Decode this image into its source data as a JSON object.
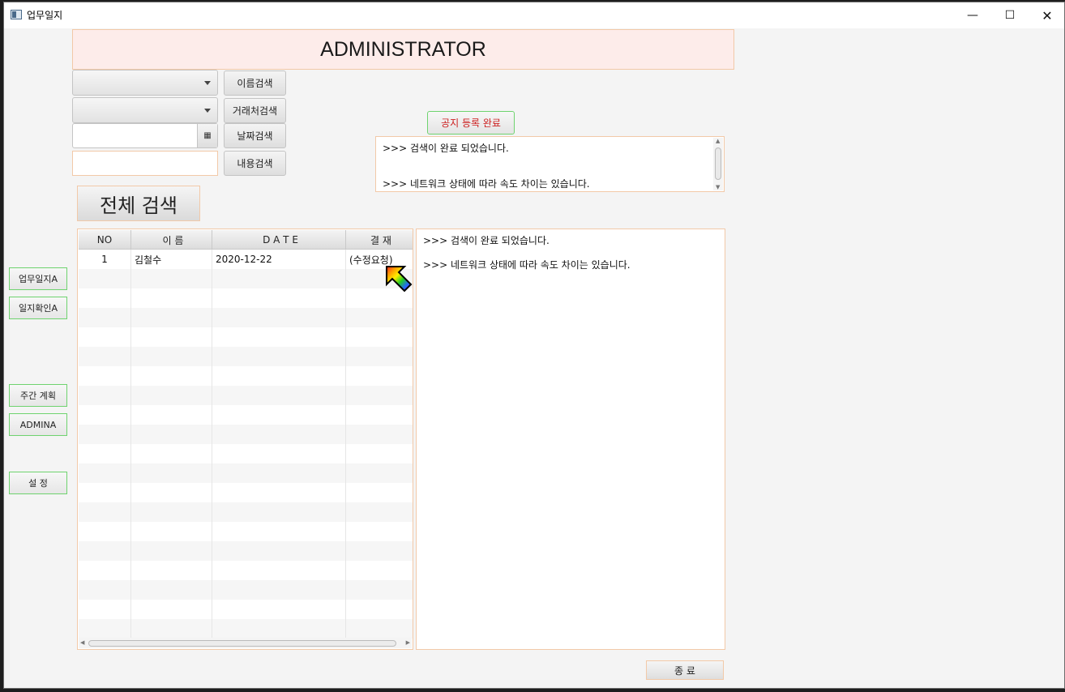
{
  "window": {
    "title": "업무일지",
    "min_glyph": "—",
    "max_glyph": "☐",
    "close_glyph": "✕"
  },
  "header": {
    "title": "ADMINISTRATOR"
  },
  "search": {
    "name_button": "이름검색",
    "client_button": "거래처검색",
    "date_button": "날짜검색",
    "content_button": "내용검색",
    "all_button": "전체 검색",
    "name_combo_value": "",
    "client_combo_value": "",
    "date_value": "",
    "content_value": "",
    "date_icon": "▦"
  },
  "notice": {
    "button": "공지 등록 완료",
    "log_lines": [
      ">>> 검색이 완료 되었습니다.",
      ">>> 네트워크 상태에 따라 속도 차이는 있습니다."
    ]
  },
  "nav": [
    {
      "label": "업무일지A"
    },
    {
      "label": "일지확인A"
    },
    {
      "label": "주간 계획"
    },
    {
      "label": "ADMINA"
    },
    {
      "label": "설  정"
    }
  ],
  "table": {
    "columns": [
      "NO",
      "이    름",
      "D  A  T  E",
      "결 재"
    ],
    "rows": [
      [
        "1",
        "김철수",
        "2020-12-22",
        "(수정요청)"
      ],
      [
        "",
        "",
        "",
        ""
      ],
      [
        "",
        "",
        "",
        ""
      ],
      [
        "",
        "",
        "",
        ""
      ],
      [
        "",
        "",
        "",
        ""
      ],
      [
        "",
        "",
        "",
        ""
      ],
      [
        "",
        "",
        "",
        ""
      ],
      [
        "",
        "",
        "",
        ""
      ],
      [
        "",
        "",
        "",
        ""
      ],
      [
        "",
        "",
        "",
        ""
      ],
      [
        "",
        "",
        "",
        ""
      ],
      [
        "",
        "",
        "",
        ""
      ],
      [
        "",
        "",
        "",
        ""
      ],
      [
        "",
        "",
        "",
        ""
      ],
      [
        "",
        "",
        "",
        ""
      ],
      [
        "",
        "",
        "",
        ""
      ],
      [
        "",
        "",
        "",
        ""
      ],
      [
        "",
        "",
        "",
        ""
      ],
      [
        "",
        "",
        "",
        ""
      ],
      [
        "",
        "",
        "",
        ""
      ]
    ]
  },
  "main_log": {
    "lines": [
      ">>> 검색이 완료 되었습니다.",
      ">>> 네트워크 상태에 따라 속도 차이는 있습니다."
    ]
  },
  "footer": {
    "exit_button": "종  료"
  },
  "colors": {
    "accent_border": "#f2c9a8",
    "nav_border": "#6fd36f",
    "header_bg": "#fdecea",
    "notice_text": "#cc1f1f"
  }
}
